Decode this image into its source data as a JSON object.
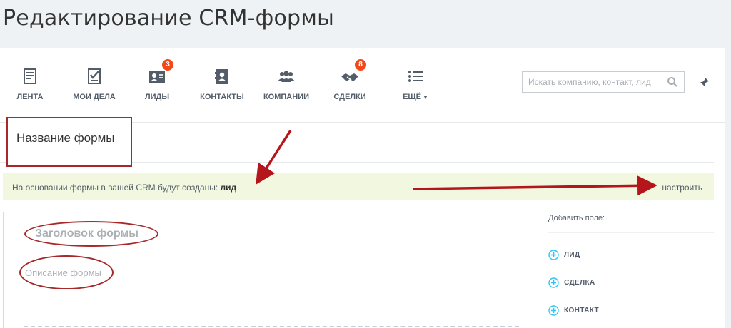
{
  "page": {
    "title": "Редактирование CRM-формы"
  },
  "nav": {
    "items": [
      {
        "label": "Лента",
        "icon": "feed-icon"
      },
      {
        "label": "Мои дела",
        "icon": "tasks-icon"
      },
      {
        "label": "Лиды",
        "icon": "leads-icon",
        "badge": "3"
      },
      {
        "label": "Контакты",
        "icon": "contacts-icon"
      },
      {
        "label": "Компании",
        "icon": "companies-icon"
      },
      {
        "label": "Сделки",
        "icon": "deals-icon",
        "badge": "8"
      },
      {
        "label": "Ещё",
        "icon": "more-icon"
      }
    ],
    "more_caret": "▼"
  },
  "search": {
    "placeholder": "Искать компанию, контакт, лид"
  },
  "form": {
    "name": "Название формы",
    "notice_text": "На основании формы в вашей CRM будут созданы:",
    "notice_entity": "лид",
    "configure_link": "настроить",
    "header_placeholder": "Заголовок формы",
    "description_placeholder": "Описание формы"
  },
  "sidebar": {
    "title": "Добавить поле:",
    "fields": [
      "Лид",
      "Сделка",
      "Контакт"
    ]
  },
  "colors": {
    "accent": "#a8282a",
    "badge": "#f54819",
    "notice_bg": "#f1f8df",
    "icon": "#535c69",
    "plus": "#2fc6f6"
  }
}
